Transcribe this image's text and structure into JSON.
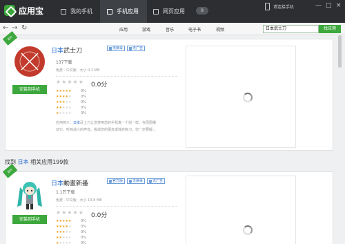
{
  "app": {
    "name": "应用宝"
  },
  "tabs": [
    {
      "label": "我的手机"
    },
    {
      "label": "手机应用"
    },
    {
      "label": "网页应用"
    }
  ],
  "badge": "8",
  "device": {
    "label": "请连接手机"
  },
  "window_controls": {
    "minimize": "—",
    "maximize": "□",
    "close": "×"
  },
  "nav": {
    "back": "←",
    "forward": "→",
    "refresh": "↻"
  },
  "categories": [
    "应用",
    "游戏",
    "音乐",
    "电子书",
    "视频"
  ],
  "search": {
    "value": "日本武士刀",
    "button": "找应用"
  },
  "apps": [
    {
      "corner": "官方",
      "title_highlight": "日本",
      "title_rest": "武士刀",
      "tags": [
        "无病毒",
        "无广告"
      ],
      "downloads": "137下载",
      "meta": "免费 · 中文版 · 大小 0.2 MB",
      "score": "0.0分",
      "ratings": [
        "0%",
        "0%",
        "0%",
        "0%",
        "0%"
      ],
      "desc_prefix": "应用简介：",
      "desc_highlight": "日本",
      "desc_line1": "武士刀让您使用您的手机像一个剑一样。在周围摆",
      "desc_line2": "动它，听到战斗的声音。挑战您的朋友或独自练习，但一定要握...",
      "install": "安装到手机"
    },
    {
      "corner": "官方",
      "title_highlight": "日本",
      "title_rest": "動畫新番",
      "tags": [
        "官方版",
        "无病毒",
        "无广告"
      ],
      "downloads": "1.1万下载",
      "meta": "免费 · 中文版 · 大小 13.8 MB",
      "score": "0.0分",
      "ratings": [
        "0%",
        "0%",
        "0%",
        "0%",
        "0%"
      ],
      "install": "安装到手机"
    }
  ],
  "result": {
    "prefix": "找到",
    "keyword": "日本",
    "suffix": "相关应用199款"
  }
}
